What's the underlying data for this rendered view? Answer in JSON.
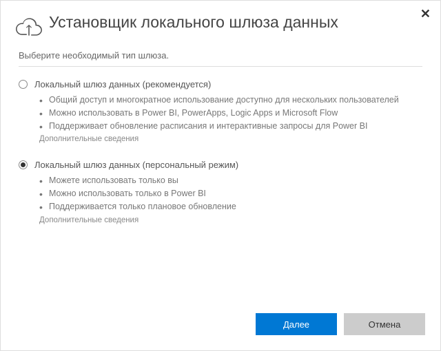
{
  "header": {
    "title": "Установщик локального шлюза данных"
  },
  "subtitle": "Выберите необходимый тип шлюза.",
  "option1": {
    "label": "Локальный шлюз данных (рекомендуется)",
    "selected": false,
    "bullets": [
      "Общий доступ и многократное использование доступно для нескольких пользователей",
      "Можно использовать в Power BI, PowerApps, Logic Apps и Microsoft Flow",
      "Поддерживает обновление расписания и интерактивные запросы для Power BI"
    ],
    "learn_more": "Дополнительные сведения"
  },
  "option2": {
    "label": "Локальный шлюз данных (персональный режим)",
    "selected": true,
    "bullets": [
      "Можете использовать только вы",
      "Можно использовать только в Power BI",
      "Поддерживается только плановое обновление"
    ],
    "learn_more": "Дополнительные сведения"
  },
  "buttons": {
    "next": "Далее",
    "cancel": "Отмена"
  }
}
